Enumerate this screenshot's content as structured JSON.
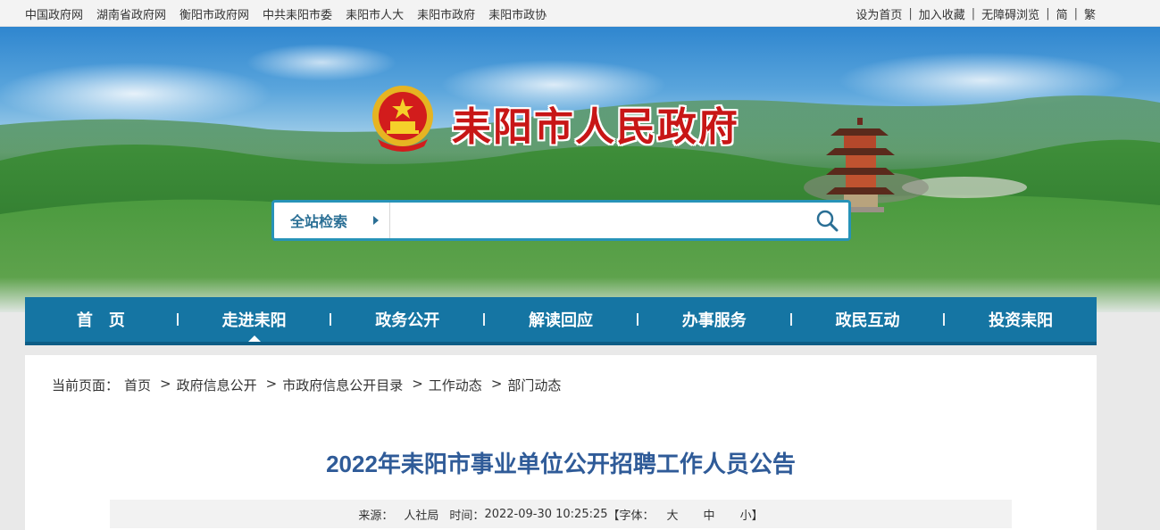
{
  "topbar": {
    "links": [
      "中国政府网",
      "湖南省政府网",
      "衡阳市政府网",
      "中共耒阳市委",
      "耒阳市人大",
      "耒阳市政府",
      "耒阳市政协"
    ],
    "right": {
      "home": "设为首页",
      "favorite": "加入收藏",
      "accessible": "无障碍浏览",
      "simplified": "简",
      "traditional": "繁"
    }
  },
  "banner": {
    "title": "耒阳市人民政府"
  },
  "search": {
    "scope_label": "全站检索",
    "placeholder": "",
    "icon": "search-icon"
  },
  "nav": {
    "items": [
      {
        "label": "首页",
        "active": false
      },
      {
        "label": "走进耒阳",
        "active": true
      },
      {
        "label": "政务公开",
        "active": false
      },
      {
        "label": "解读回应",
        "active": false
      },
      {
        "label": "办事服务",
        "active": false
      },
      {
        "label": "政民互动",
        "active": false
      },
      {
        "label": "投资耒阳",
        "active": false
      }
    ]
  },
  "breadcrumb": {
    "prefix": "当前页面：",
    "items": [
      "首页",
      "政府信息公开",
      "市政府信息公开目录",
      "工作动态",
      "部门动态"
    ]
  },
  "article": {
    "title": "2022年耒阳市事业单位公开招聘工作人员公告",
    "meta": {
      "source_label": "来源：",
      "source": "人社局",
      "time_label": "时间：",
      "time": "2022-09-30 10:25:25",
      "font_label": "【字体：",
      "font_large": "大",
      "font_medium": "中",
      "font_small": "小",
      "font_close": "】"
    }
  },
  "colors": {
    "nav_bg": "#1575a3",
    "title_red": "#c81616",
    "article_title": "#2f5b98",
    "search_border": "#2793b8"
  }
}
